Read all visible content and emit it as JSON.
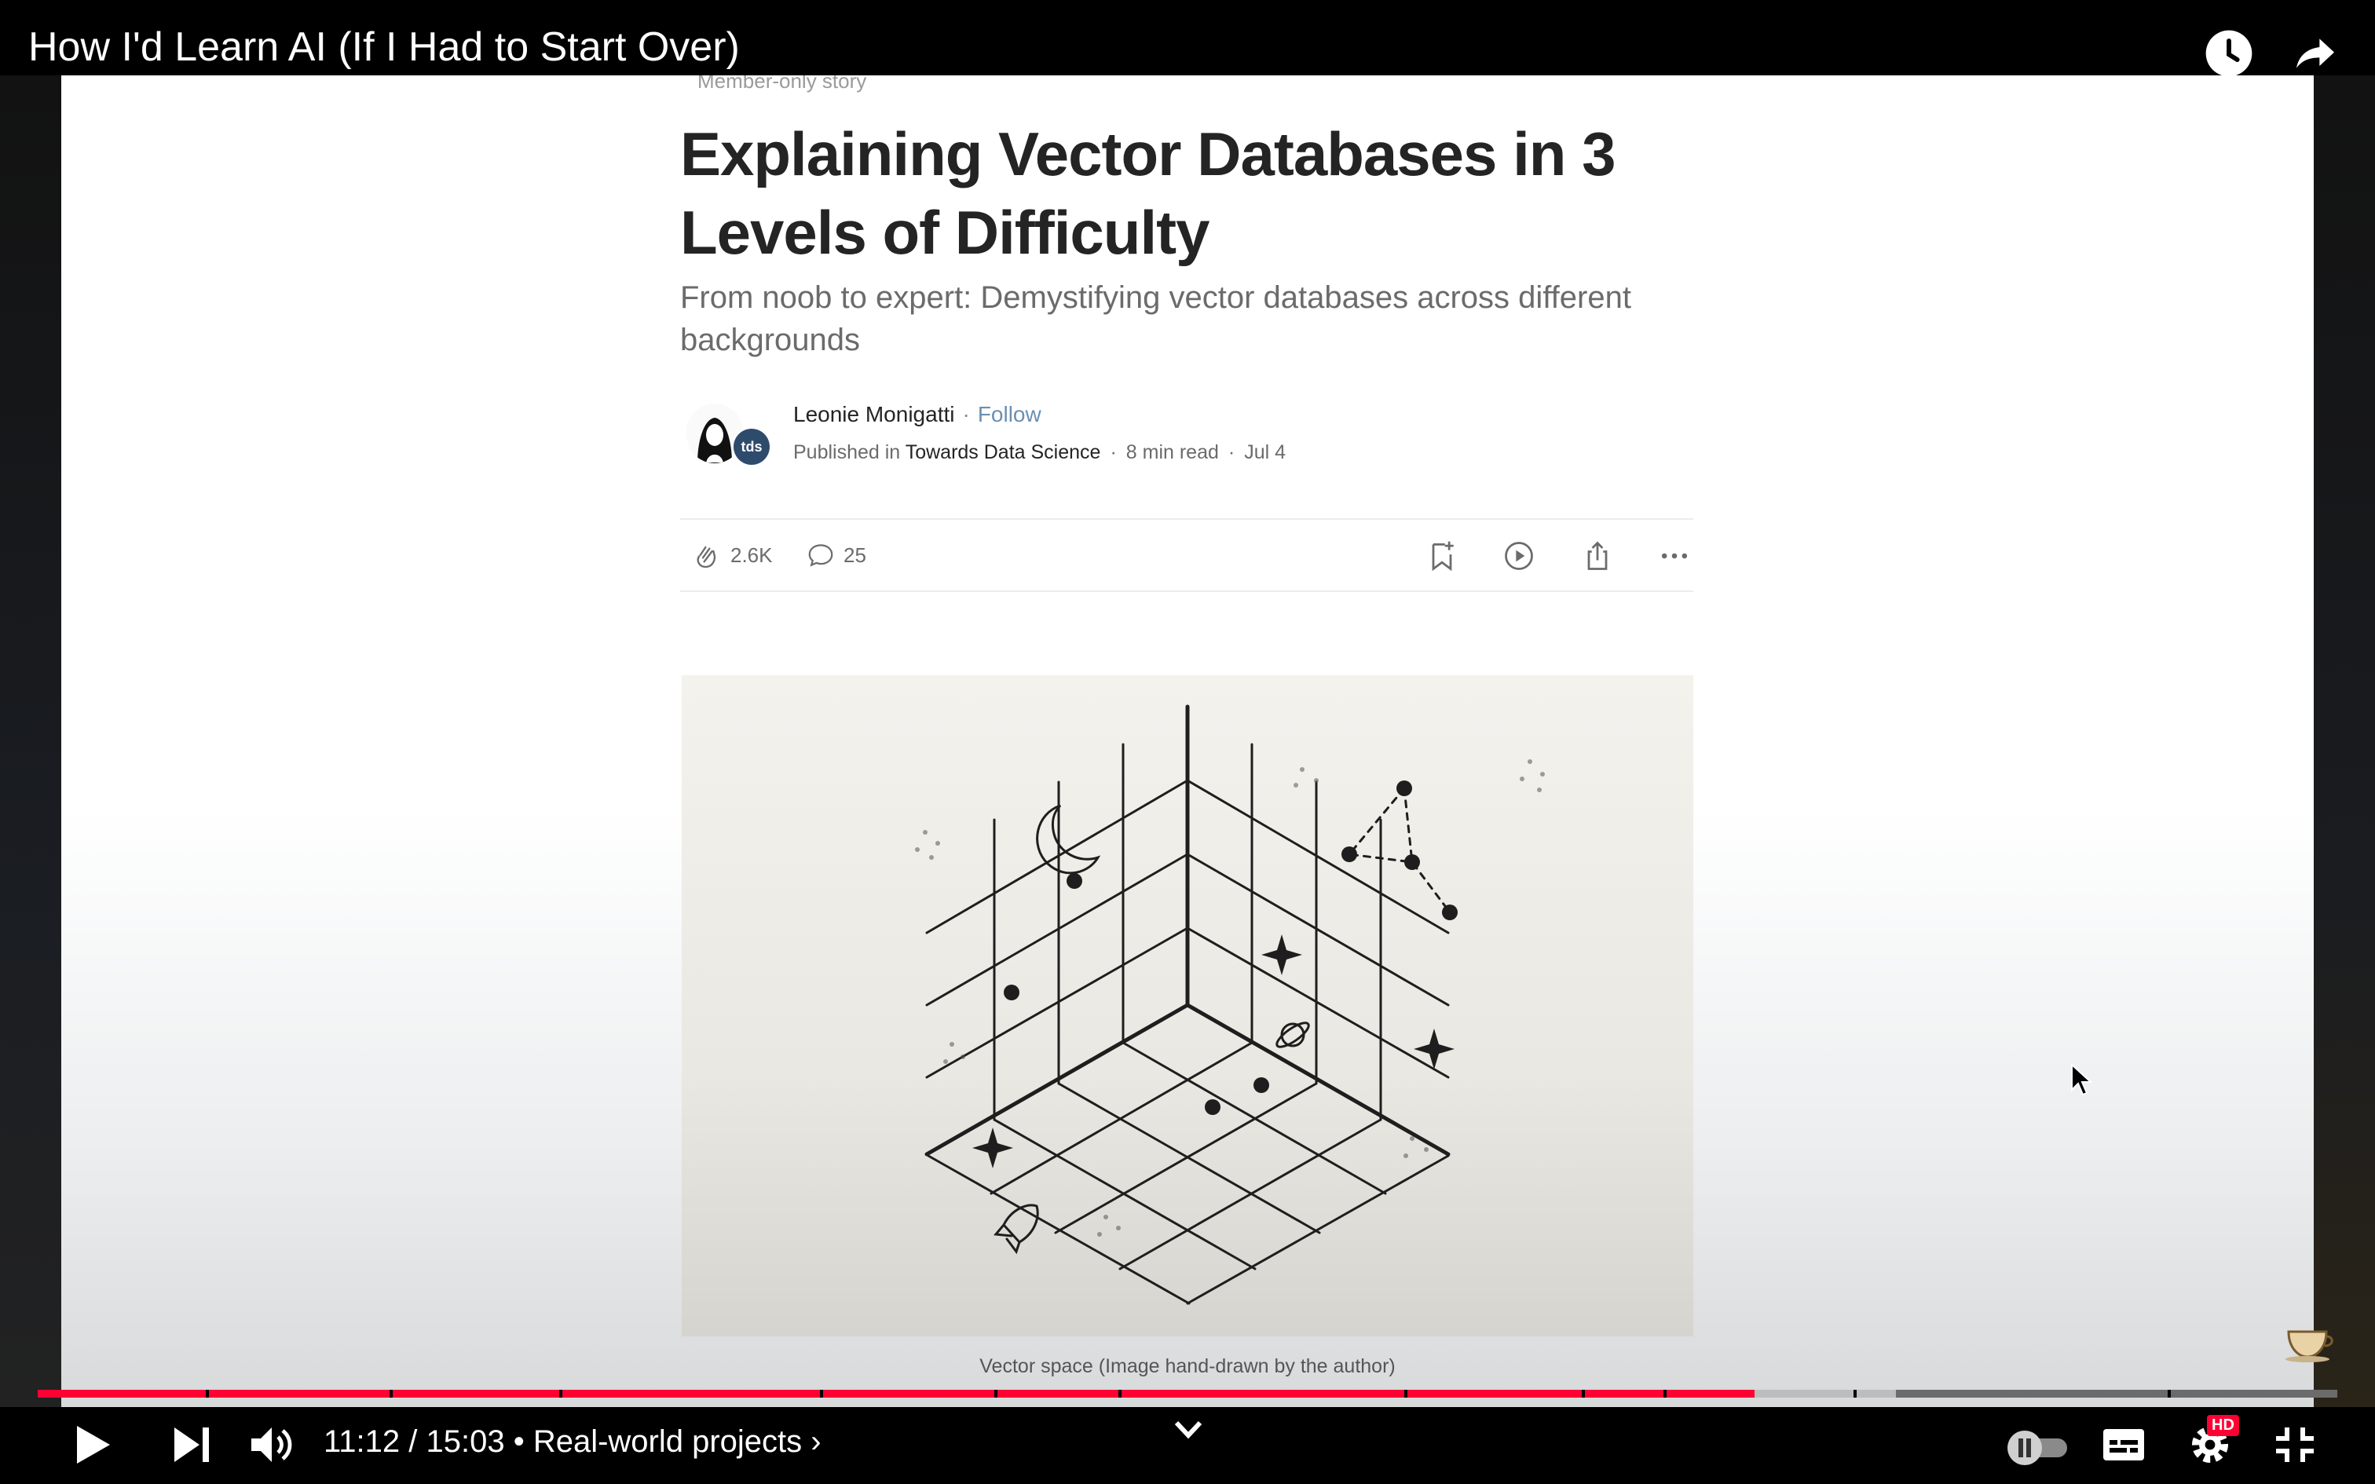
{
  "player": {
    "video_title": "How I'd Learn AI (If I Had to Start Over)",
    "time_display": "11:12 / 15:03",
    "chapter_label": "• Real-world projects ›",
    "progress_fraction": 0.745,
    "hd_badge": "HD",
    "colors": {
      "progress_played": "#ff0033",
      "background": "#000000"
    },
    "icons": [
      "watch-later-icon",
      "share-icon",
      "play-icon",
      "next-icon",
      "volume-icon",
      "chevron-down-icon",
      "autoplay-toggle-icon",
      "subtitles-icon",
      "settings-icon",
      "exit-fullscreen-icon"
    ]
  },
  "article": {
    "member_label": "Member-only story",
    "title": "Explaining Vector Databases in 3 Levels of Difficulty",
    "subtitle": "From noob to expert: Demystifying vector databases across different backgrounds",
    "author": "Leonie Monigatti",
    "separator": "·",
    "follow_label": "Follow",
    "published_in_label": "Published in",
    "publication": "Towards Data Science",
    "publication_badge": "tds",
    "read_time": "8 min read",
    "date": "Jul 4",
    "claps": "2.6K",
    "comments": "25",
    "caption": "Vector space (Image hand-drawn by the author)"
  }
}
